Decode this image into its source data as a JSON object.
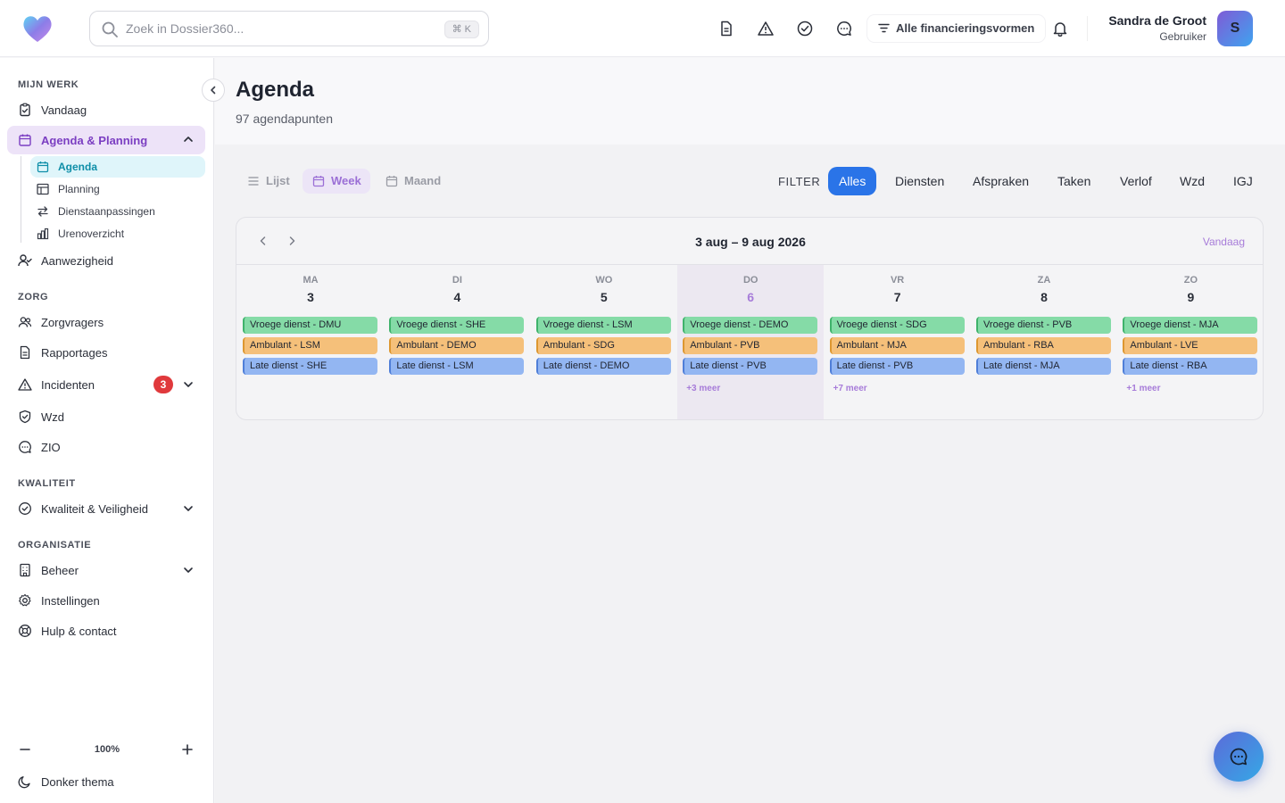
{
  "search": {
    "placeholder": "Zoek in Dossier360...",
    "shortcut": "⌘ K"
  },
  "topbar": {
    "icons": [
      "document-icon",
      "warning-icon",
      "check-circle-icon",
      "chat-icon"
    ],
    "financing_label": "Alle financieringsvormen",
    "user_name": "Sandra de Groot",
    "user_role": "Gebruiker",
    "avatar_initial": "S"
  },
  "sidebar": {
    "section_mijn_werk": "MIJN WERK",
    "vandaag": "Vandaag",
    "agenda_planning": "Agenda & Planning",
    "sub_items": [
      "Agenda",
      "Planning",
      "Dienstaanpassingen",
      "Urenoverzicht"
    ],
    "aanwezigheid": "Aanwezigheid",
    "section_zorg": "ZORG",
    "zorgvragers": "Zorgvragers",
    "rapportages": "Rapportages",
    "incidenten": "Incidenten",
    "incidenten_badge": "3",
    "wzd": "Wzd",
    "zio": "ZIO",
    "section_kwaliteit": "KWALITEIT",
    "kwaliteit": "Kwaliteit & Veiligheid",
    "section_organisatie": "ORGANISATIE",
    "beheer": "Beheer",
    "instellingen": "Instellingen",
    "hulp": "Hulp & contact",
    "zoom": "100%",
    "dark_theme": "Donker thema"
  },
  "page": {
    "title": "Agenda",
    "subtitle": "97 agendapunten"
  },
  "views": [
    "Lijst",
    "Week",
    "Maand"
  ],
  "active_view": "Week",
  "filter": {
    "label": "FILTER",
    "chips": [
      "Alles",
      "Diensten",
      "Afspraken",
      "Taken",
      "Verlof",
      "Wzd",
      "IGJ"
    ],
    "active": "Alles"
  },
  "calendar": {
    "range": "3 aug – 9 aug 2026",
    "today_label": "Vandaag",
    "days": [
      {
        "name": "MA",
        "num": "3",
        "events": [
          "Vroege dienst - DMU",
          "Ambulant - LSM",
          "Late dienst - SHE"
        ],
        "more": ""
      },
      {
        "name": "DI",
        "num": "4",
        "events": [
          "Vroege dienst - SHE",
          "Ambulant - DEMO",
          "Late dienst - LSM"
        ],
        "more": ""
      },
      {
        "name": "WO",
        "num": "5",
        "events": [
          "Vroege dienst - LSM",
          "Ambulant - SDG",
          "Late dienst - DEMO"
        ],
        "more": ""
      },
      {
        "name": "DO",
        "num": "6",
        "events": [
          "Vroege dienst - DEMO",
          "Ambulant - PVB",
          "Late dienst - PVB"
        ],
        "more": "+3 meer"
      },
      {
        "name": "VR",
        "num": "7",
        "events": [
          "Vroege dienst - SDG",
          "Ambulant - MJA",
          "Late dienst - PVB"
        ],
        "more": "+7 meer"
      },
      {
        "name": "ZA",
        "num": "8",
        "events": [
          "Vroege dienst - PVB",
          "Ambulant - RBA",
          "Late dienst - MJA"
        ],
        "more": ""
      },
      {
        "name": "ZO",
        "num": "9",
        "events": [
          "Vroege dienst - MJA",
          "Ambulant - LVE",
          "Late dienst - RBA"
        ],
        "more": "+1 meer"
      }
    ],
    "today_index": 3
  },
  "colors": {
    "accent": "#7b3ec2",
    "primary": "#2a74e8",
    "early_shift": "#85dba7",
    "ambulant": "#f5c07a",
    "late_shift": "#93b6f2"
  }
}
